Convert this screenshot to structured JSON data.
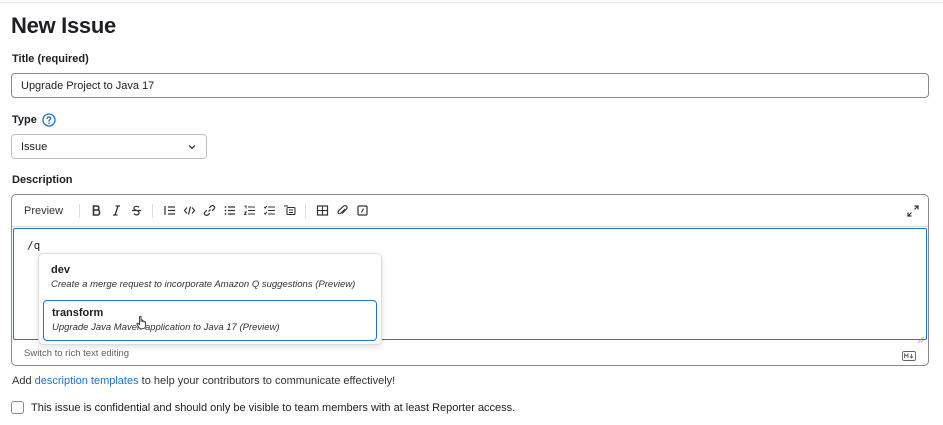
{
  "page": {
    "title": "New Issue"
  },
  "title_field": {
    "label": "Title (required)",
    "value": "Upgrade Project to Java 17"
  },
  "type_field": {
    "label": "Type",
    "selected": "Issue"
  },
  "description": {
    "label": "Description",
    "toolbar": {
      "preview_label": "Preview",
      "buttons": [
        "bold",
        "italic",
        "strikethrough",
        "quote",
        "code",
        "link",
        "bullet-list",
        "numbered-list",
        "task-list",
        "collapsible",
        "table",
        "attach",
        "comment"
      ]
    },
    "content": "/q",
    "switch_label": "Switch to rich text editing"
  },
  "autocomplete": {
    "items": [
      {
        "name": "dev",
        "description": "Create a merge request to incorporate Amazon Q suggestions (Preview)"
      },
      {
        "name": "transform",
        "description": "Upgrade Java Maven application to Java 17 (Preview)"
      }
    ]
  },
  "help": {
    "prefix": "Add",
    "link": "description templates",
    "suffix": "to help your contributors to communicate effectively!"
  },
  "confidential": {
    "label": "This issue is confidential and should only be visible to team members with at least Reporter access.",
    "checked": false
  },
  "colors": {
    "accent": "#1f75cb",
    "text": "#1f1e24",
    "border": "#89888d"
  }
}
